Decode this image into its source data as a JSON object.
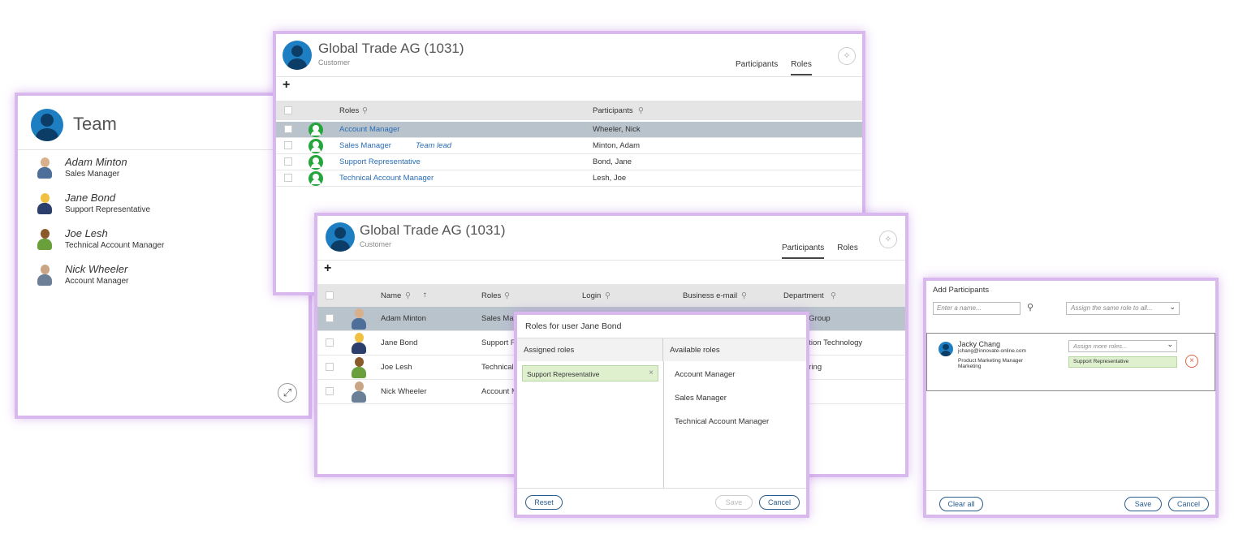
{
  "team": {
    "title": "Team",
    "members": [
      {
        "name": "Adam Minton",
        "role": "Sales Manager"
      },
      {
        "name": "Jane Bond",
        "role": "Support Representative"
      },
      {
        "name": "Joe Lesh",
        "role": "Technical Account Manager"
      },
      {
        "name": "Nick Wheeler",
        "role": "Account Manager"
      }
    ],
    "expand_icon": "expand-icon"
  },
  "roles_panel": {
    "title": "Global Trade AG (1031)",
    "subtitle": "Customer",
    "tabs": [
      "Participants",
      "Roles"
    ],
    "active_tab": "Roles",
    "add_icon": "+",
    "columns": {
      "roles": "Roles",
      "participants": "Participants"
    },
    "rows": [
      {
        "role": "Account Manager",
        "participant": "Wheeler, Nick",
        "tag": ""
      },
      {
        "role": "Sales Manager",
        "participant": "Minton, Adam",
        "tag": "Team lead"
      },
      {
        "role": "Support Representative",
        "participant": "Bond, Jane",
        "tag": ""
      },
      {
        "role": "Technical Account Manager",
        "participant": "Lesh, Joe",
        "tag": ""
      }
    ]
  },
  "participants_panel": {
    "title": "Global Trade AG (1031)",
    "subtitle": "Customer",
    "tabs": [
      "Participants",
      "Roles"
    ],
    "active_tab": "Participants",
    "add_icon": "+",
    "columns": {
      "name": "Name",
      "roles": "Roles",
      "login": "Login",
      "email": "Business e-mail",
      "department": "Department"
    },
    "rows": [
      {
        "name": "Adam Minton",
        "roles": "Sales Mar",
        "dept": "t Group"
      },
      {
        "name": "Jane Bond",
        "roles": "Support Re",
        "dept": "ation Technology"
      },
      {
        "name": "Joe Lesh",
        "roles": "Technical A",
        "dept": "ering"
      },
      {
        "name": "Nick Wheeler",
        "roles": "Account M",
        "dept": ""
      }
    ]
  },
  "roles_dialog": {
    "title": "Roles for user Jane Bond",
    "assigned_header": "Assigned roles",
    "available_header": "Available roles",
    "assigned": [
      "Support Representative"
    ],
    "available": [
      "Account Manager",
      "Sales Manager",
      "Technical Account Manager"
    ],
    "reset": "Reset",
    "save": "Save",
    "cancel": "Cancel",
    "remove_glyph": "×"
  },
  "add_participants": {
    "title": "Add Participants",
    "name_placeholder": "Enter a name...",
    "role_placeholder": "Assign the same role to all...",
    "person": {
      "name": "Jacky Chang",
      "email": "jchang@innovate-online.com",
      "title": "Product Marketing Manager",
      "dept": "Marketing"
    },
    "more_roles_placeholder": "Assign more roles...",
    "assigned_role": "Support Representative",
    "clear_all": "Clear all",
    "save": "Save",
    "cancel": "Cancel"
  },
  "colors": {
    "accent": "#d9b8ee",
    "selected_row": "#b8c3cc",
    "link": "#2a6db5",
    "role_chip": "#dff0cf"
  }
}
